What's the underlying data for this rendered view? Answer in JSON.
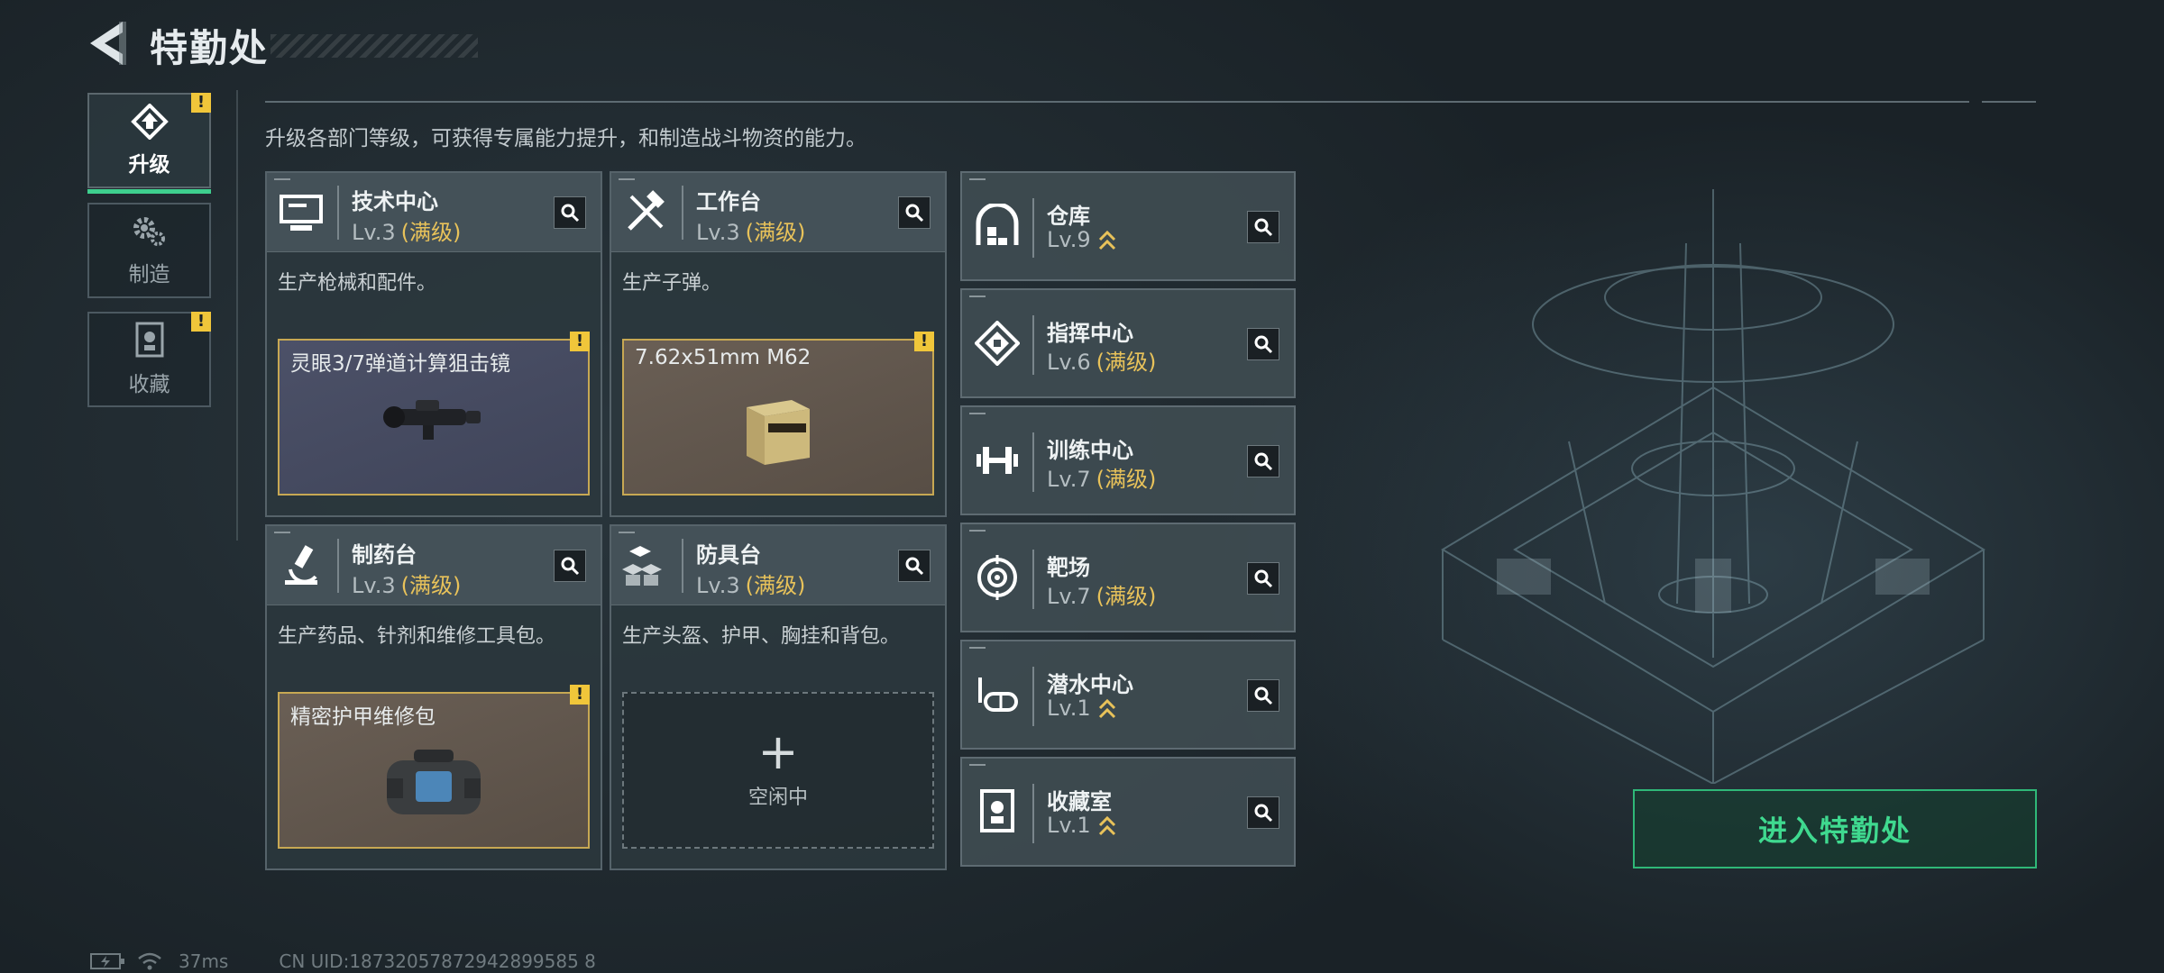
{
  "header": {
    "title": "特勤处"
  },
  "tabs": [
    {
      "label": "升级",
      "active": true,
      "alert": "!"
    },
    {
      "label": "制造",
      "active": false,
      "alert": ""
    },
    {
      "label": "收藏",
      "active": false,
      "alert": "!"
    }
  ],
  "description": "升级各部门等级，可获得专属能力提升，和制造战斗物资的能力。",
  "workstations": [
    {
      "name": "技术中心",
      "level": "Lv.3",
      "status": "(满级)",
      "desc": "生产枪械和配件。",
      "icon": "monitor-icon",
      "product": {
        "name": "灵眼3/7弹道计算狙击镜",
        "alert": "!",
        "image": "scope-icon"
      }
    },
    {
      "name": "工作台",
      "level": "Lv.3",
      "status": "(满级)",
      "desc": "生产子弹。",
      "icon": "tools-icon",
      "product": {
        "name": "7.62x51mm M62",
        "alert": "!",
        "image": "ammo-box-icon"
      }
    },
    {
      "name": "制药台",
      "level": "Lv.3",
      "status": "(满级)",
      "desc": "生产药品、针剂和维修工具包。",
      "icon": "microscope-icon",
      "product": {
        "name": "精密护甲维修包",
        "alert": "!",
        "image": "repair-kit-icon"
      }
    },
    {
      "name": "防具台",
      "level": "Lv.3",
      "status": "(满级)",
      "desc": "生产头盔、护甲、胸挂和背包。",
      "icon": "armor-blocks-icon",
      "idle": {
        "plus": "+",
        "label": "空闲中"
      }
    }
  ],
  "facilities": [
    {
      "name": "仓库",
      "level": "Lv.9",
      "status": "",
      "upgradable": true,
      "icon": "warehouse-icon"
    },
    {
      "name": "指挥中心",
      "level": "Lv.6",
      "status": "(满级)",
      "upgradable": false,
      "icon": "command-icon"
    },
    {
      "name": "训练中心",
      "level": "Lv.7",
      "status": "(满级)",
      "upgradable": false,
      "icon": "dumbbell-icon"
    },
    {
      "name": "靶场",
      "level": "Lv.7",
      "status": "(满级)",
      "upgradable": false,
      "icon": "target-icon"
    },
    {
      "name": "潜水中心",
      "level": "Lv.1",
      "status": "",
      "upgradable": true,
      "icon": "diving-mask-icon"
    },
    {
      "name": "收藏室",
      "level": "Lv.1",
      "status": "",
      "upgradable": true,
      "icon": "collection-icon"
    }
  ],
  "enter_button": {
    "label": "进入特勤处"
  },
  "status_bar": {
    "ping": "37ms",
    "uid": "CN UID:18732057872942899585 8"
  },
  "colors": {
    "accent": "#3fd98f",
    "maxed": "#e8c25a",
    "alert": "#f0c63a"
  }
}
